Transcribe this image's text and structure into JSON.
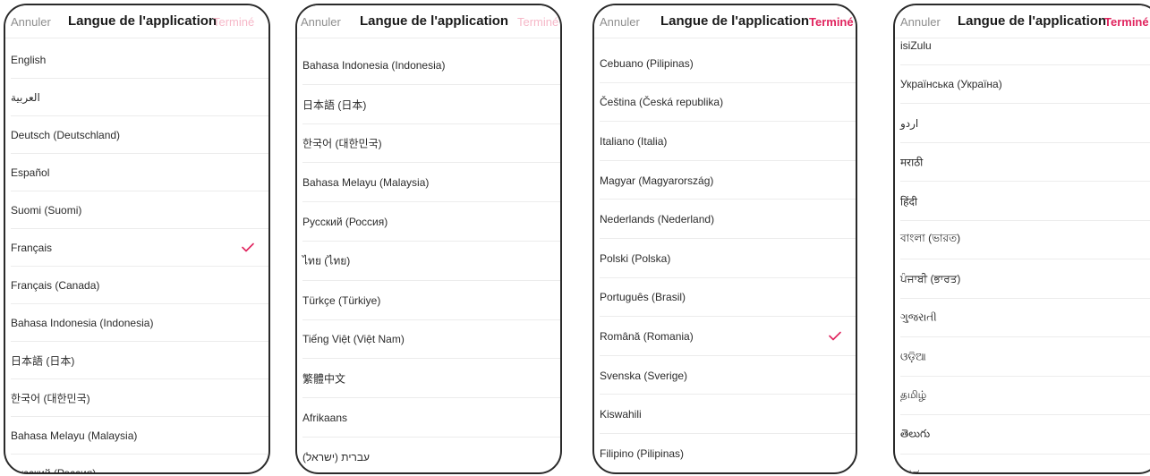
{
  "colors": {
    "accent": "#e0245e",
    "accent_faded": "#f6b8c8",
    "border": "#2a2a2a"
  },
  "panels": [
    {
      "header": {
        "cancel": "Annuler",
        "title": "Langue de l'application",
        "done": "Terminé",
        "done_active": false
      },
      "rows": [
        "English",
        "العربية",
        "Deutsch (Deutschland)",
        "Español",
        "Suomi (Suomi)",
        "Français",
        "Français (Canada)",
        "Bahasa Indonesia (Indonesia)",
        "日本語 (日本)",
        "한국어 (대한민국)",
        "Bahasa Melayu (Malaysia)",
        "Русский (Россия)"
      ],
      "checked_index": 5
    },
    {
      "header": {
        "cancel": "Annuler",
        "title": "Langue de l'application",
        "done": "Terminé",
        "done_active": false
      },
      "rows": [
        "Bahasa Indonesia (Indonesia)",
        "日本語 (日本)",
        "한국어 (대한민국)",
        "Bahasa Melayu (Malaysia)",
        "Русский (Россия)",
        "ไทย (ไทย)",
        "Türkçe (Türkiye)",
        "Tiếng Việt (Việt Nam)",
        "繁體中文",
        "Afrikaans",
        "עברית (ישראל)"
      ],
      "checked_index": -1
    },
    {
      "header": {
        "cancel": "Annuler",
        "title": "Langue de l'application",
        "done": "Terminé",
        "done_active": true
      },
      "rows": [
        "Cebuano (Pilipinas)",
        "Čeština (Česká republika)",
        "Italiano (Italia)",
        "Magyar (Magyarország)",
        "Nederlands (Nederland)",
        "Polski (Polska)",
        "Português (Brasil)",
        "Română (Romania)",
        "Svenska (Sverige)",
        "Kiswahili",
        "Filipino (Pilipinas)"
      ],
      "checked_index": 7
    },
    {
      "header": {
        "cancel": "Annuler",
        "title": "Langue de l'application",
        "done": "Terminé",
        "done_active": true
      },
      "rows": [
        "isiZulu",
        "Українська (Україна)",
        "اردو",
        "मराठी",
        "हिंदी",
        "বাংলা (ভারত)",
        "ਪੰਜਾਬੀ (ਭਾਰਤ)",
        "ગુજરાતી",
        "ଓଡ଼ିଆ",
        "தமிழ்",
        "తెలుగు",
        "ಕನ್ನಡ"
      ],
      "checked_index": -1
    }
  ]
}
